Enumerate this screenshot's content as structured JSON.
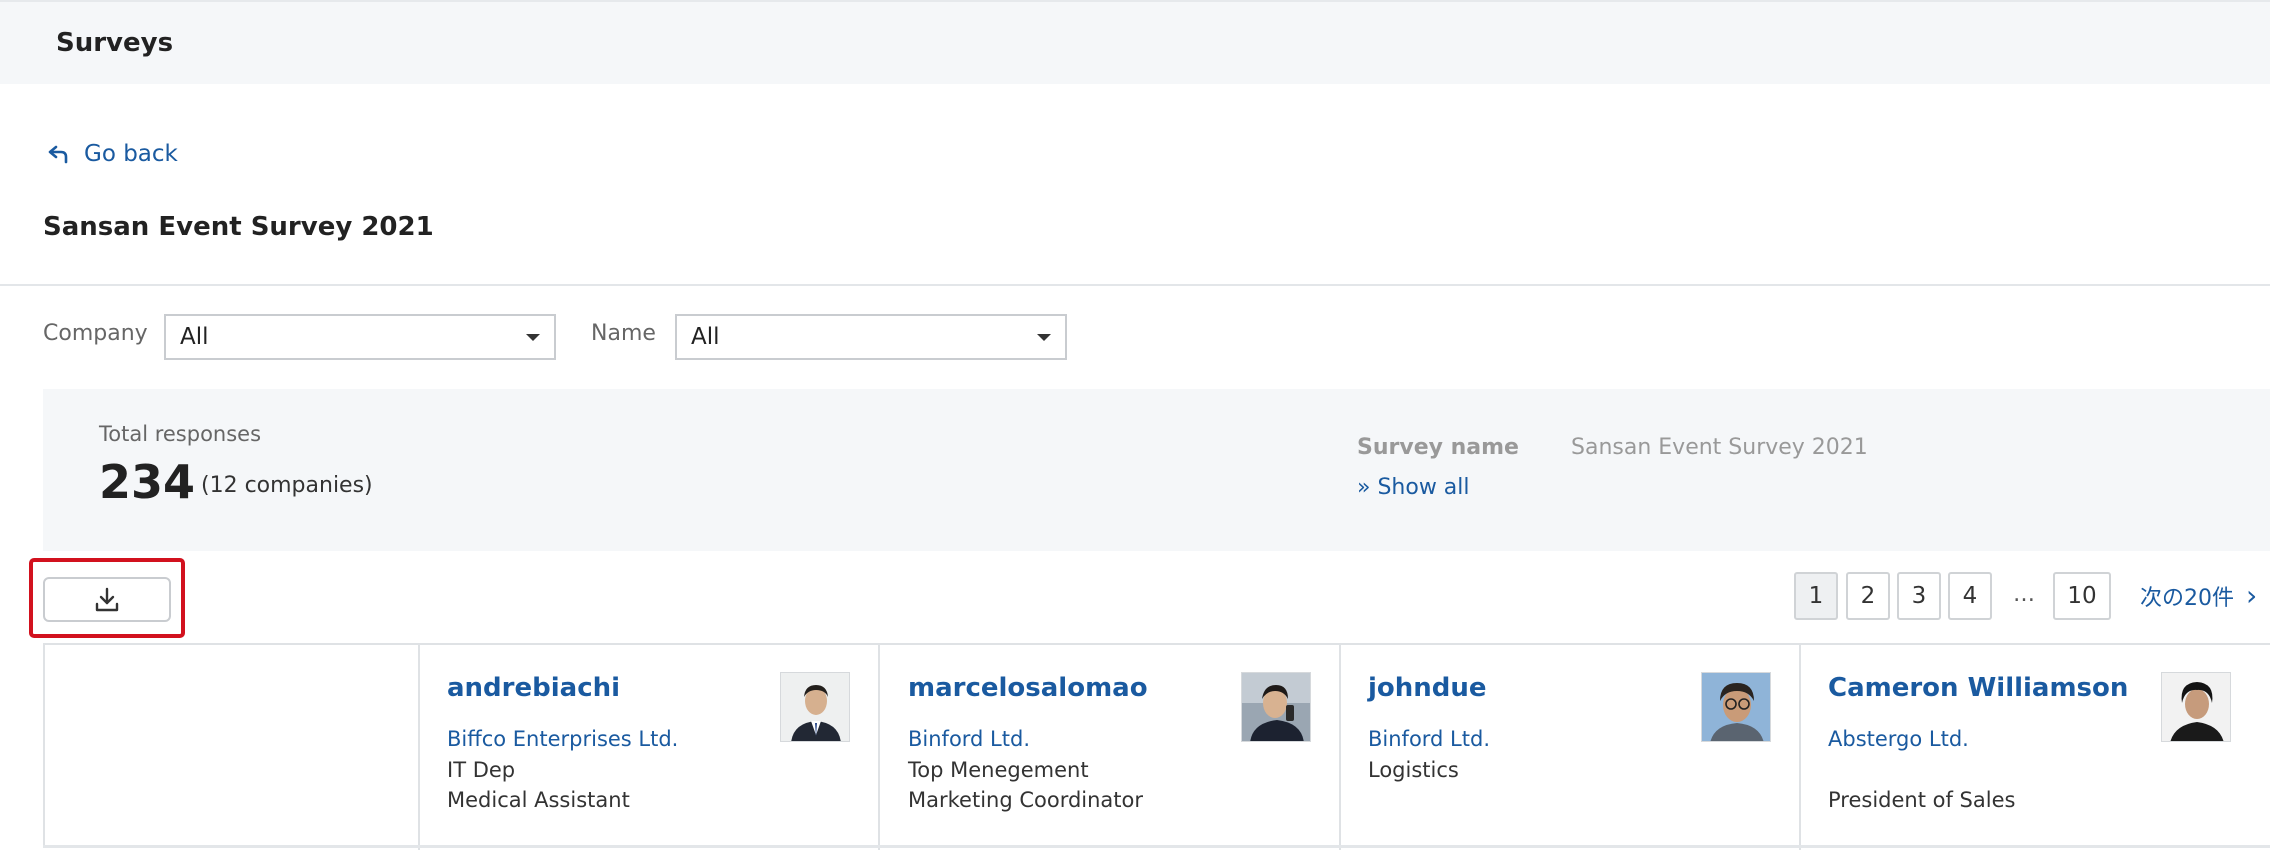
{
  "header": {
    "title": "Surveys"
  },
  "nav": {
    "go_back": "Go back"
  },
  "page": {
    "title": "Sansan Event Survey 2021"
  },
  "filters": {
    "company_label": "Company",
    "company_value": "All",
    "name_label": "Name",
    "name_value": "All"
  },
  "summary": {
    "total_label": "Total responses",
    "total_value": "234",
    "companies_text": "(12 companies)",
    "survey_name_label": "Survey name",
    "survey_name_value": "Sansan Event Survey 2021",
    "show_all": "» Show all"
  },
  "toolbar": {
    "download_icon": "download-icon"
  },
  "pagination": {
    "pages": [
      "1",
      "2",
      "3",
      "4",
      "10"
    ],
    "active": "1",
    "ellipsis": "…",
    "next_label": "次の20件",
    "next_icon": "chevron-right-icon"
  },
  "respondents": [
    {
      "name": "andrebiachi",
      "company": "Biffco Enterprises Ltd.",
      "line1": "IT Dep",
      "line2": "Medical Assistant"
    },
    {
      "name": "marcelosalomao",
      "company": "Binford Ltd.",
      "line1": "Top Menegement",
      "line2": "Marketing Coordinator"
    },
    {
      "name": "johndue",
      "company": "Binford Ltd.",
      "line1": "Logistics",
      "line2": ""
    },
    {
      "name": "Cameron Williamson",
      "company": "Abstergo Ltd.",
      "line1": "",
      "line2": "President of Sales"
    }
  ],
  "colors": {
    "link": "#1a5aa0",
    "highlight": "#d2111e",
    "panel": "#f5f7f9"
  }
}
